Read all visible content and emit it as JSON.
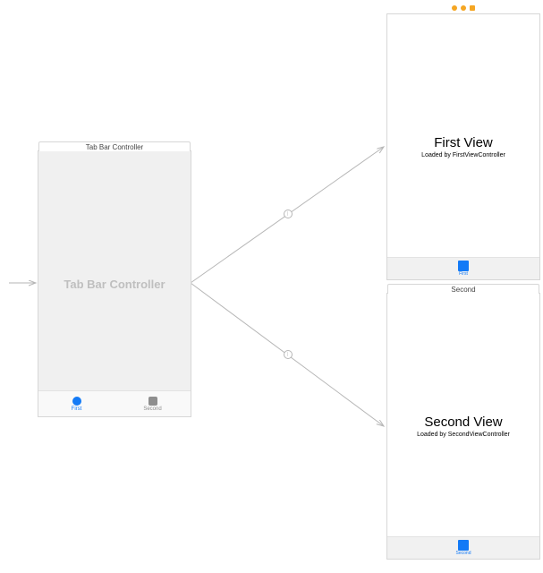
{
  "scenes": {
    "tabController": {
      "title": "Tab Bar Controller",
      "placeholder": "Tab Bar Controller",
      "tabs": [
        {
          "label": "First"
        },
        {
          "label": "Second"
        }
      ]
    },
    "first": {
      "title": "First View",
      "subtitle": "Loaded by FirstViewController",
      "tabLabel": "First"
    },
    "second": {
      "sceneTitle": "Second",
      "title": "Second View",
      "subtitle": "Loaded by SecondViewController",
      "tabLabel": "Second"
    }
  }
}
